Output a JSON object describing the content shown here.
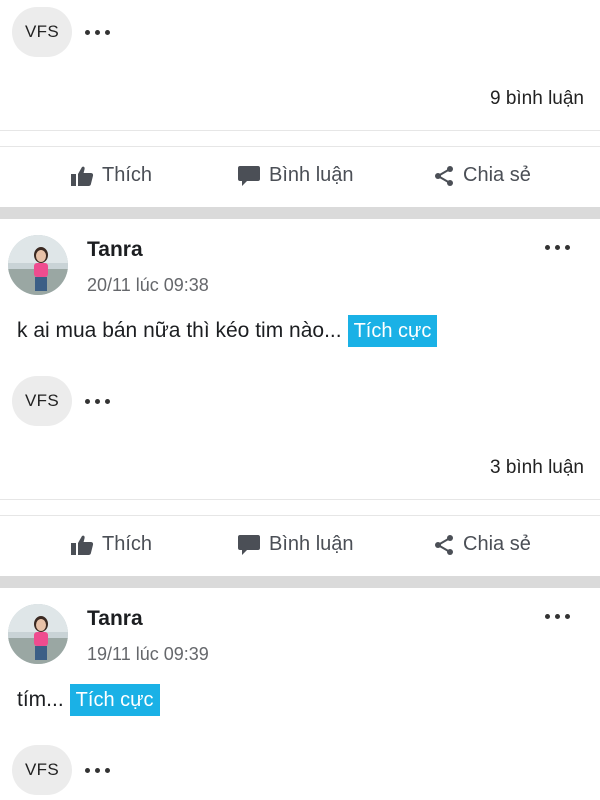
{
  "colors": {
    "tag_bg": "#1ab1e6",
    "separator": "#dadada",
    "chip_bg": "#ececec"
  },
  "top_post": {
    "commenter_chip": "VFS",
    "comment_count": "9 bình luận",
    "actions": {
      "like": "Thích",
      "comment": "Bình luận",
      "share": "Chia sẻ"
    }
  },
  "posts": [
    {
      "author": "Tanra",
      "timestamp": "20/11 lúc 09:38",
      "text": "k ai mua bán nữa thì kéo tim nào...",
      "tag": "Tích cực",
      "commenter_chip": "VFS",
      "comment_count": "3 bình luận",
      "actions": {
        "like": "Thích",
        "comment": "Bình luận",
        "share": "Chia sẻ"
      }
    },
    {
      "author": "Tanra",
      "timestamp": "19/11 lúc 09:39",
      "text": "tím...",
      "tag": "Tích cực",
      "commenter_chip": "VFS"
    }
  ]
}
